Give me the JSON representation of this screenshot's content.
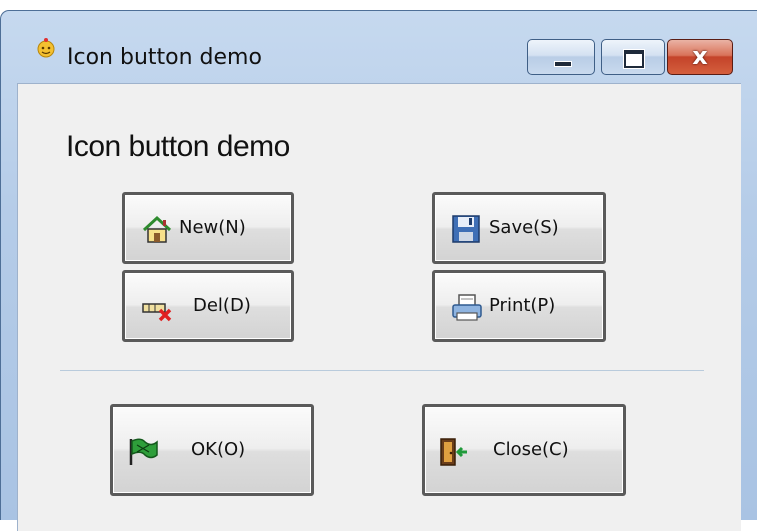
{
  "window": {
    "title": "Icon button demo",
    "app_icon": "app-icon",
    "controls": {
      "minimize": "minimize-icon",
      "maximize": "maximize-icon",
      "close_glyph": "x"
    }
  },
  "content": {
    "heading": "Icon button demo",
    "buttons": [
      {
        "label": "New(N)",
        "icon": "home-icon"
      },
      {
        "label": "Save(S)",
        "icon": "floppy-disk-icon"
      },
      {
        "label": "Del(D)",
        "icon": "delete-icon"
      },
      {
        "label": "Print(P)",
        "icon": "printer-icon"
      },
      {
        "label": "OK(O)",
        "icon": "flag-icon"
      },
      {
        "label": "Close(C)",
        "icon": "exit-door-icon"
      }
    ]
  },
  "colors": {
    "frame": "#b5cce8",
    "client": "#f0f0f0",
    "close_button": "#c4432a",
    "button_border": "#5a5a5a"
  }
}
